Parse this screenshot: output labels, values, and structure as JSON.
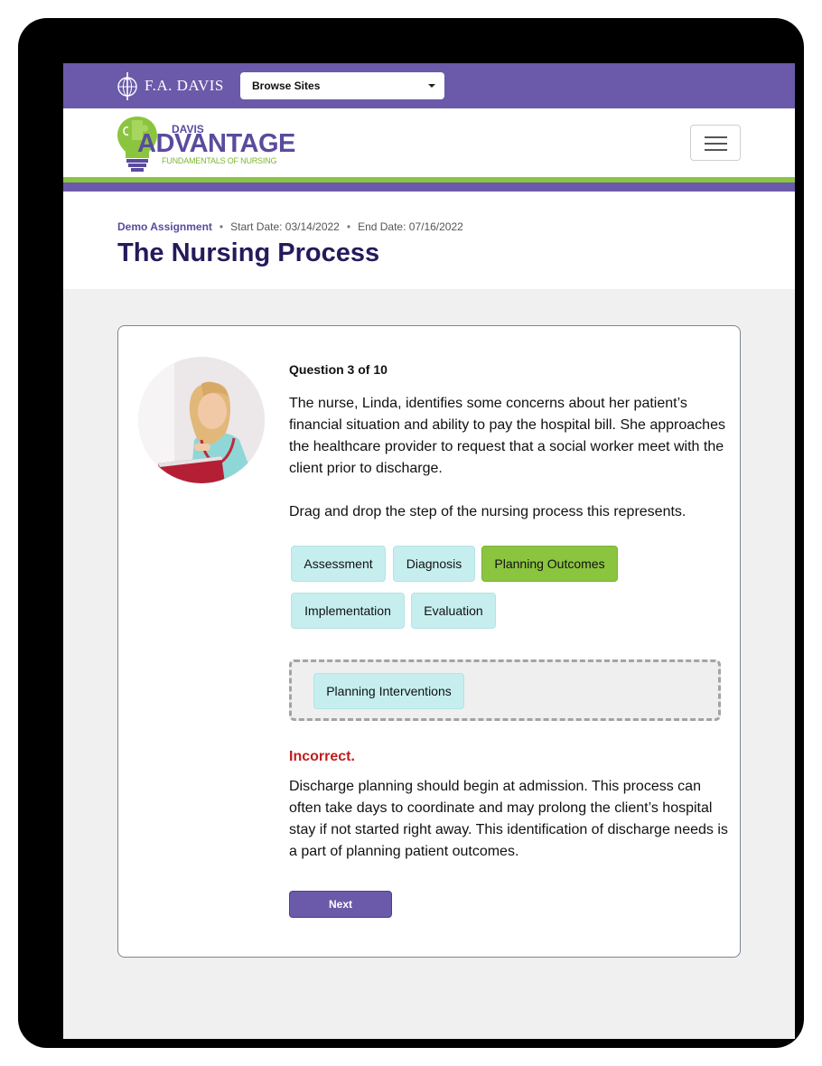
{
  "topbar": {
    "publisher": "F.A. DAVIS",
    "browse_label": "Browse Sites"
  },
  "brand": {
    "line1": "DAVIS",
    "line2": "ADVANTAGE",
    "line3": "FUNDAMENTALS OF NURSING",
    "colors": {
      "purple": "#6a5aa9",
      "green": "#8bc53f"
    }
  },
  "assignment": {
    "name": "Demo Assignment",
    "start": "Start Date: 03/14/2022",
    "end": "End Date: 07/16/2022",
    "separator": "•",
    "title": "The Nursing Process"
  },
  "question": {
    "counter": "Question 3 of 10",
    "prompt": "The nurse, Linda, identifies some concerns about her patient’s financial situation and ability to pay the hospital bill. She approaches the healthcare provider to request that a social worker meet with the client prior to discharge.",
    "instruction": "Drag and drop the step of the nursing process this represents.",
    "options": [
      "Assessment",
      "Diagnosis",
      "Planning Outcomes",
      "Implementation",
      "Evaluation"
    ],
    "correct_option": "Planning Outcomes",
    "dropped_answer": "Planning Interventions"
  },
  "feedback": {
    "status": "Incorrect.",
    "explanation": "Discharge planning should begin at admission. This process can often take days to coordinate and may prolong the client’s hospital stay if not started right away. This identification of discharge needs is a part of planning patient outcomes."
  },
  "next_label": "Next",
  "colors": {
    "incorrect": "#c11d1d",
    "chip": "#c6eeef",
    "chip_selected": "#8bc53f",
    "title": "#231b5b"
  }
}
